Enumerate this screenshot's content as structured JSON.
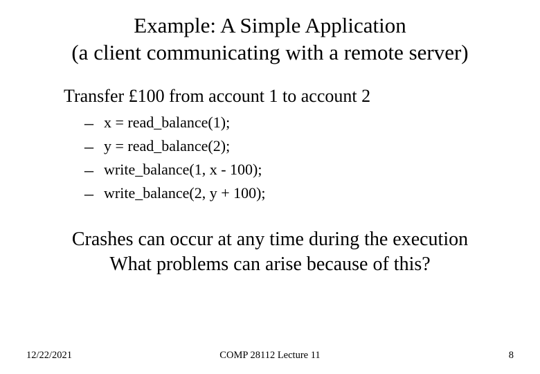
{
  "title": {
    "line1": "Example: A Simple Application",
    "line2": "(a client communicating with a remote server)"
  },
  "lead": "Transfer £100 from account 1 to account 2",
  "code": [
    "x = read_balance(1);",
    "y = read_balance(2);",
    "write_balance(1, x - 100);",
    "write_balance(2, y + 100);"
  ],
  "closing": {
    "line1": "Crashes can occur at any time during the execution",
    "line2": "What problems can arise because of this?"
  },
  "footer": {
    "date": "12/22/2021",
    "course": "COMP 28112 Lecture 11",
    "page": "8"
  },
  "dash": "–"
}
